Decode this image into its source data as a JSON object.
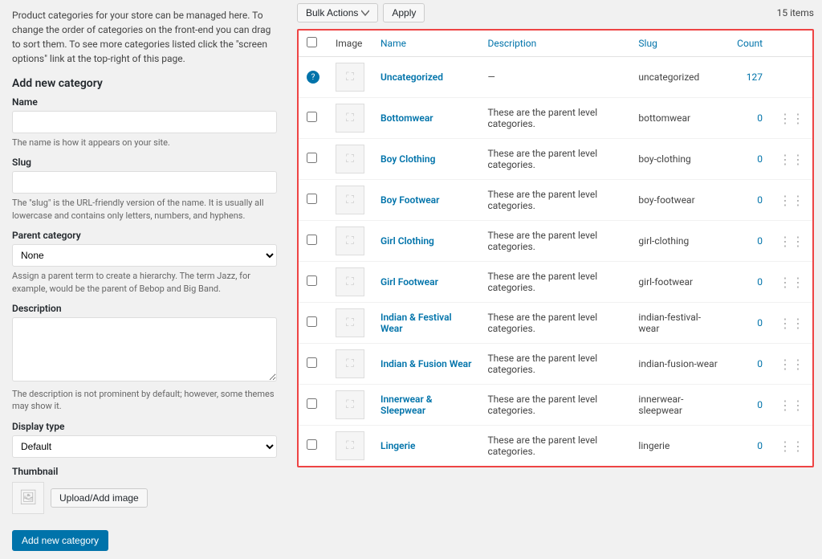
{
  "left": {
    "intro": "Product categories for your store can be managed here. To change the order of categories on the front-end you can drag to sort them. To see more categories listed click the \"screen options\" link at the top-right of this page.",
    "section_title": "Add new category",
    "name_label": "Name",
    "name_placeholder": "",
    "name_hint": "The name is how it appears on your site.",
    "slug_label": "Slug",
    "slug_placeholder": "",
    "slug_hint": "The \"slug\" is the URL-friendly version of the name. It is usually all lowercase and contains only letters, numbers, and hyphens.",
    "parent_label": "Parent category",
    "parent_default": "None",
    "parent_hint": "Assign a parent term to create a hierarchy. The term Jazz, for example, would be the parent of Bebop and Big Band.",
    "description_label": "Description",
    "description_hint": "The description is not prominent by default; however, some themes may show it.",
    "display_label": "Display type",
    "display_default": "Default",
    "thumbnail_label": "Thumbnail",
    "upload_btn": "Upload/Add image",
    "add_btn": "Add new category"
  },
  "right": {
    "bulk_actions": "Bulk Actions",
    "apply": "Apply",
    "items_count": "15 items",
    "columns": {
      "image": "Image",
      "name": "Name",
      "description": "Description",
      "slug": "Slug",
      "count": "Count"
    },
    "uncategorized": {
      "name": "Uncategorized",
      "description": "—",
      "slug": "uncategorized",
      "count": "127"
    },
    "rows": [
      {
        "name": "Bottomwear",
        "description": "These are the parent level categories.",
        "slug": "bottomwear",
        "count": "0"
      },
      {
        "name": "Boy Clothing",
        "description": "These are the parent level categories.",
        "slug": "boy-clothing",
        "count": "0"
      },
      {
        "name": "Boy Footwear",
        "description": "These are the parent level categories.",
        "slug": "boy-footwear",
        "count": "0"
      },
      {
        "name": "Girl Clothing",
        "description": "These are the parent level categories.",
        "slug": "girl-clothing",
        "count": "0"
      },
      {
        "name": "Girl Footwear",
        "description": "These are the parent level categories.",
        "slug": "girl-footwear",
        "count": "0"
      },
      {
        "name": "Indian & Festival Wear",
        "description": "These are the parent level categories.",
        "slug": "indian-festival-wear",
        "count": "0"
      },
      {
        "name": "Indian & Fusion Wear",
        "description": "These are the parent level categories.",
        "slug": "indian-fusion-wear",
        "count": "0"
      },
      {
        "name": "Innerwear & Sleepwear",
        "description": "These are the parent level categories.",
        "slug": "innerwear-sleepwear",
        "count": "0"
      },
      {
        "name": "Lingerie",
        "description": "These are the parent level categories.",
        "slug": "lingerie",
        "count": "0"
      }
    ]
  }
}
